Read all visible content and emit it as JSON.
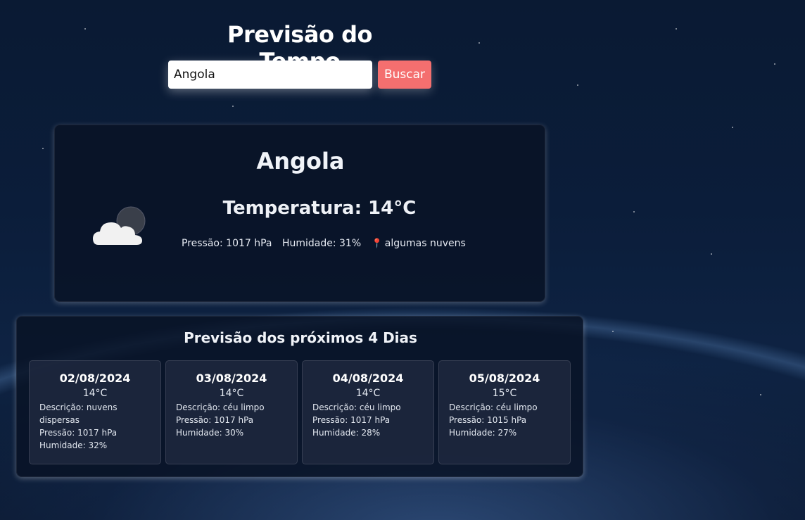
{
  "header": {
    "title": "Previsão do Tempo",
    "search_value": "Angola",
    "search_button": "Buscar"
  },
  "current": {
    "city": "Angola",
    "temperature": "Temperatura: 14°C",
    "pressure": "Pressão: 1017 hPa",
    "humidity": "Humidade: 31%",
    "description": "algumas nuvens",
    "icon": "partly-cloudy-night-icon"
  },
  "forecast": {
    "title": "Previsão dos próximos 4 Dias",
    "days": [
      {
        "date": "02/08/2024",
        "temp": "14°C",
        "description": "Descrição: nuvens dispersas",
        "pressure": "Pressão: 1017 hPa",
        "humidity": "Humidade: 32%"
      },
      {
        "date": "03/08/2024",
        "temp": "14°C",
        "description": "Descrição: céu limpo",
        "pressure": "Pressão: 1017 hPa",
        "humidity": "Humidade: 30%"
      },
      {
        "date": "04/08/2024",
        "temp": "14°C",
        "description": "Descrição: céu limpo",
        "pressure": "Pressão: 1017 hPa",
        "humidity": "Humidade: 28%"
      },
      {
        "date": "05/08/2024",
        "temp": "15°C",
        "description": "Descrição: céu limpo",
        "pressure": "Pressão: 1015 hPa",
        "humidity": "Humidade: 27%"
      }
    ]
  },
  "colors": {
    "accent_button": "#f46f6f",
    "background": "#0b1d3a",
    "card": "#091224"
  }
}
